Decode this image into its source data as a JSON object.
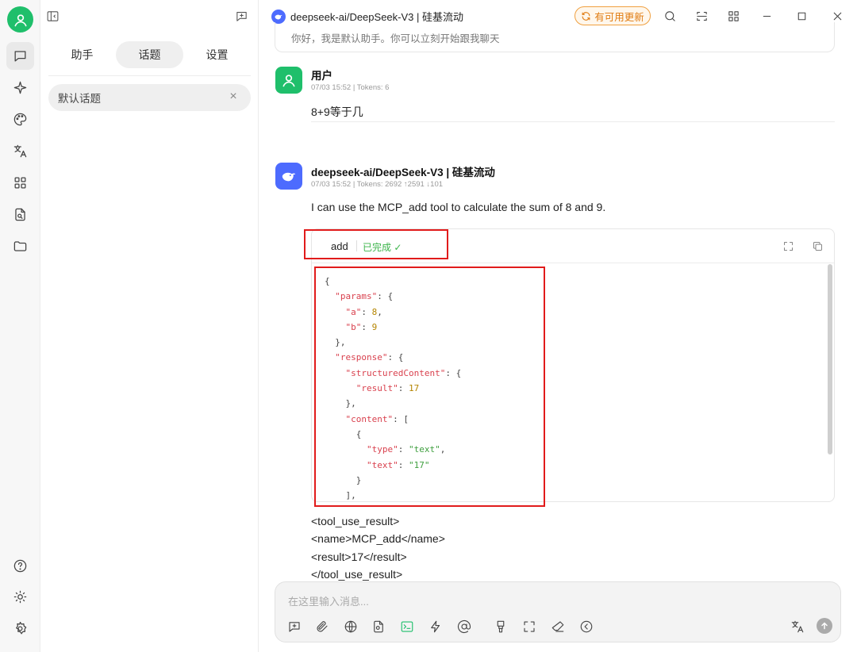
{
  "rail": {
    "items": [
      "chat",
      "agents",
      "paintings",
      "translate",
      "apps",
      "files-notes",
      "folder"
    ],
    "bottom": [
      "help",
      "theme",
      "settings"
    ]
  },
  "panel": {
    "tabs": [
      "助手",
      "话题",
      "设置"
    ],
    "active_tab": 1,
    "topics": [
      {
        "title": "默认话题"
      }
    ]
  },
  "header": {
    "model_title": "deepseek-ai/DeepSeek-V3 | 硅基流动",
    "update_label": "有可用更新"
  },
  "previous_message": "你好，我是默认助手。你可以立刻开始跟我聊天",
  "user_message": {
    "name": "用户",
    "meta": "07/03 15:52  |  Tokens: 6",
    "text": "8+9等于几"
  },
  "assistant_message": {
    "name": "deepseek-ai/DeepSeek-V3 | 硅基流动",
    "meta": "07/03 15:52  |  Tokens: 2692 ↑2591 ↓101",
    "text": "I can use the MCP_add tool to calculate the sum of 8 and 9.",
    "tool": {
      "name": "add",
      "status": "已完成 ✓"
    },
    "tool_result_lines": [
      "<tool_use_result>",
      "<name>MCP_add</name>",
      "<result>17</result>",
      "</tool_use_result>"
    ]
  },
  "json_code": {
    "params_key": "\"params\"",
    "a_key": "\"a\"",
    "a_val": "8",
    "b_key": "\"b\"",
    "b_val": "9",
    "response_key": "\"response\"",
    "structured_key": "\"structuredContent\"",
    "result_key": "\"result\"",
    "result_val": "17",
    "content_key": "\"content\"",
    "type_key": "\"type\"",
    "type_val": "\"text\"",
    "text_key": "\"text\"",
    "text_val": "\"17\""
  },
  "input": {
    "placeholder": "在这里输入消息..."
  },
  "colors": {
    "brand_green": "#1fbf6b",
    "deepseek_blue": "#4d6bfe",
    "update_orange": "#e07b10",
    "highlight_red": "#e11b1b"
  }
}
